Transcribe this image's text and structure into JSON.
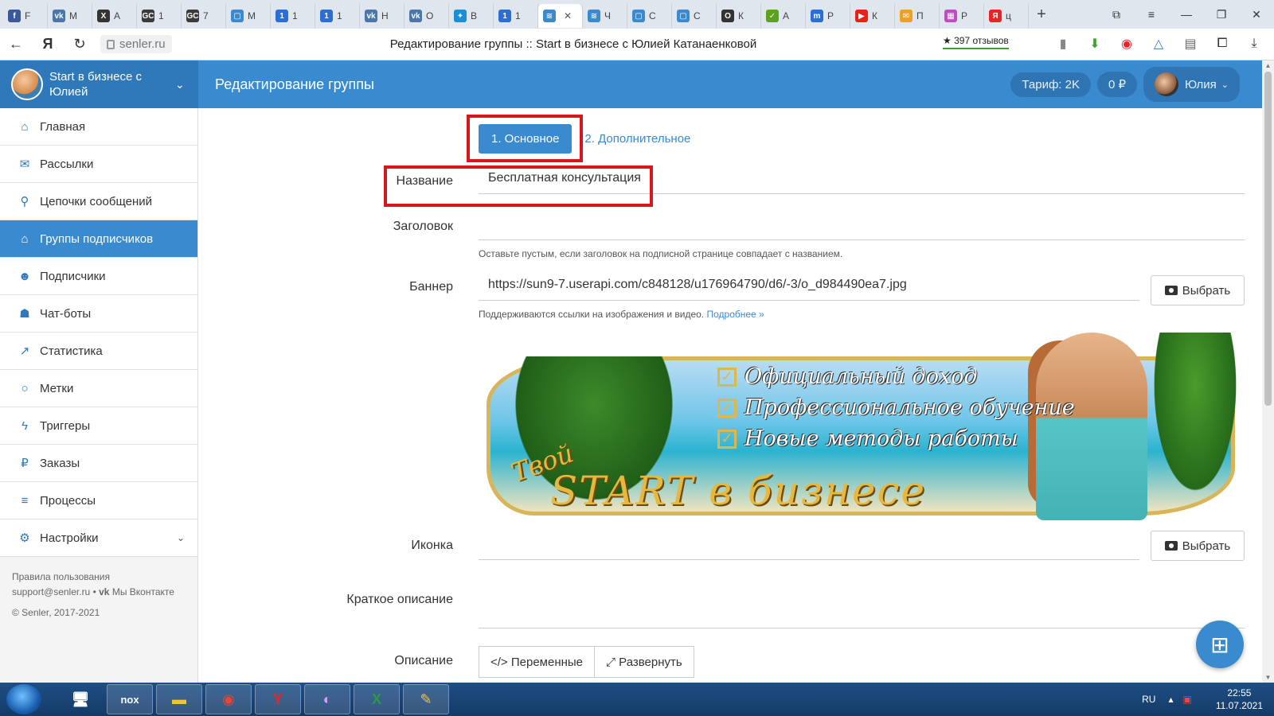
{
  "browser": {
    "tabs": [
      {
        "icon": "facebook-icon",
        "label": "F",
        "color": "#3b5998",
        "glyph": "f"
      },
      {
        "icon": "vk-icon",
        "label": "М",
        "color": "#4a76a8",
        "glyph": "vk"
      },
      {
        "icon": "x-icon",
        "label": "А",
        "color": "#333333",
        "glyph": "X"
      },
      {
        "icon": "gc-icon",
        "label": "1",
        "color": "#3a3a3a",
        "glyph": "GC"
      },
      {
        "icon": "gc-icon",
        "label": "7",
        "color": "#3a3a3a",
        "glyph": "GC"
      },
      {
        "icon": "chat-icon",
        "label": "М",
        "color": "#3a8ad0",
        "glyph": "▢"
      },
      {
        "icon": "num-icon",
        "label": "1",
        "color": "#2a6fd6",
        "glyph": "1"
      },
      {
        "icon": "num-icon",
        "label": "1",
        "color": "#2a6fd6",
        "glyph": "1"
      },
      {
        "icon": "vk-icon",
        "label": "Н",
        "color": "#4a76a8",
        "glyph": "vk"
      },
      {
        "icon": "vk-icon",
        "label": "О",
        "color": "#4a76a8",
        "glyph": "vk"
      },
      {
        "icon": "runner-icon",
        "label": "В",
        "color": "#1b8fd6",
        "glyph": "✦"
      },
      {
        "icon": "num-icon",
        "label": "1",
        "color": "#2a6fd6",
        "glyph": "1"
      },
      {
        "icon": "senler-icon",
        "label": "",
        "color": "#3a8ad0",
        "glyph": "≋",
        "active": true
      },
      {
        "icon": "senler-icon",
        "label": "Ч",
        "color": "#3a8ad0",
        "glyph": "≋"
      },
      {
        "icon": "chat-icon",
        "label": "С",
        "color": "#3a8ad0",
        "glyph": "▢"
      },
      {
        "icon": "chat-icon",
        "label": "С",
        "color": "#3a8ad0",
        "glyph": "▢"
      },
      {
        "icon": "ring-icon",
        "label": "К",
        "color": "#333333",
        "glyph": "O"
      },
      {
        "icon": "check-icon",
        "label": "А",
        "color": "#5aa31b",
        "glyph": "✓"
      },
      {
        "icon": "m-icon",
        "label": "Р",
        "color": "#2a6fd6",
        "glyph": "m"
      },
      {
        "icon": "youtube-icon",
        "label": "К",
        "color": "#e62117",
        "glyph": "▶"
      },
      {
        "icon": "mail-icon",
        "label": "П",
        "color": "#f0a020",
        "glyph": "✉"
      },
      {
        "icon": "grid-icon",
        "label": "Р",
        "color": "#c04cc0",
        "glyph": "▦"
      },
      {
        "icon": "yandex-icon",
        "label": "ц",
        "color": "#e22",
        "glyph": "Я"
      }
    ],
    "address": "senler.ru",
    "page_title": "Редактирование группы :: Start в бизнесе с Юлией Катанаенковой",
    "reviews": "★ 397 отзывов"
  },
  "header": {
    "brand_name": "Start в бизнесе с Юлией",
    "title": "Редактирование группы",
    "tariff": "Тариф: 2K",
    "balance": "0 ₽",
    "user": "Юлия"
  },
  "sidebar": {
    "items": [
      {
        "label": "Главная",
        "icon": "home-icon",
        "glyph": "⌂"
      },
      {
        "label": "Рассылки",
        "icon": "envelope-icon",
        "glyph": "✉"
      },
      {
        "label": "Цепочки сообщений",
        "icon": "chain-icon",
        "glyph": "⚲"
      },
      {
        "label": "Группы подписчиков",
        "icon": "tags-icon",
        "glyph": "⌂",
        "active": true
      },
      {
        "label": "Подписчики",
        "icon": "users-icon",
        "glyph": "☻"
      },
      {
        "label": "Чат-боты",
        "icon": "android-icon",
        "glyph": "☗"
      },
      {
        "label": "Статистика",
        "icon": "chart-icon",
        "glyph": "↗"
      },
      {
        "label": "Метки",
        "icon": "circle-icon",
        "glyph": "○"
      },
      {
        "label": "Триггеры",
        "icon": "bolt-icon",
        "glyph": "ϟ"
      },
      {
        "label": "Заказы",
        "icon": "ruble-icon",
        "glyph": "₽"
      },
      {
        "label": "Процессы",
        "icon": "list-icon",
        "glyph": "≡"
      },
      {
        "label": "Настройки",
        "icon": "gears-icon",
        "glyph": "⚙",
        "expand": true
      }
    ],
    "footer": {
      "terms": "Правила пользования",
      "support": "support@senler.ru",
      "vk": "Мы Вконтакте",
      "copyright": "© Senler, 2017-2021"
    }
  },
  "form": {
    "tabs": {
      "main": "1. Основное",
      "extra": "2. Дополнительное"
    },
    "name_label": "Название",
    "name_value": "Бесплатная консультация",
    "heading_label": "Заголовок",
    "heading_value": "",
    "heading_help": "Оставьте пустым, если заголовок на подписной странице совпадает с названием.",
    "banner_label": "Баннер",
    "banner_value": "https://sun9-7.userapi.com/c848128/u176964790/d6/-3/o_d984490ea7.jpg",
    "choose": "Выбрать",
    "banner_help": "Поддерживаются ссылки на изображения и видео.",
    "banner_more": "Подробнее »",
    "icon_label": "Иконка",
    "short_desc_label": "Краткое описание",
    "desc_label": "Описание",
    "variables_btn": "</> Переменные",
    "expand_btn": "⤢ Развернуть"
  },
  "banner_image": {
    "line1": "Официальный доход",
    "line2": "Профессиональное обучение",
    "line3": "Новые методы работы",
    "tvoi": "Твой",
    "start": "START в бизнесе"
  },
  "taskbar": {
    "lang": "RU",
    "time": "22:55",
    "date": "11.07.2021"
  }
}
